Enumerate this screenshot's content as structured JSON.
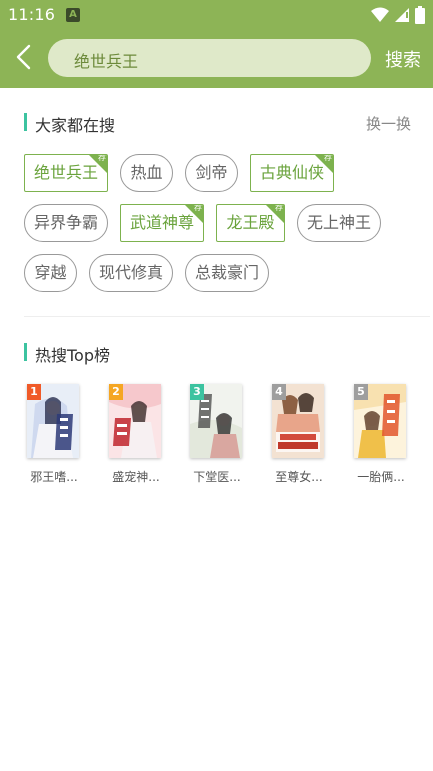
{
  "status": {
    "time": "11:16",
    "notif_icon": "A"
  },
  "search": {
    "query": "绝世兵王",
    "button_label": "搜索"
  },
  "hot_section": {
    "title": "大家都在搜",
    "refresh_label": "换一换"
  },
  "hot_tags": [
    {
      "label": "绝世兵王",
      "recommended": true
    },
    {
      "label": "热血",
      "recommended": false
    },
    {
      "label": "剑帝",
      "recommended": false
    },
    {
      "label": "古典仙侠",
      "recommended": true
    },
    {
      "label": "异界争霸",
      "recommended": false
    },
    {
      "label": "武道神尊",
      "recommended": true
    },
    {
      "label": "龙王殿",
      "recommended": true
    },
    {
      "label": "无上神王",
      "recommended": false
    },
    {
      "label": "穿越",
      "recommended": false
    },
    {
      "label": "现代修真",
      "recommended": false
    },
    {
      "label": "总裁豪门",
      "recommended": false
    }
  ],
  "rec_badge": "荐",
  "top_section": {
    "title": "热搜Top榜"
  },
  "top_books": [
    {
      "rank": "1",
      "title": "邪王嗜...",
      "badge_color": "#f05a28"
    },
    {
      "rank": "2",
      "title": "盛宠神...",
      "badge_color": "#f5a623"
    },
    {
      "rank": "3",
      "title": "下堂医...",
      "badge_color": "#3cc3a0"
    },
    {
      "rank": "4",
      "title": "至尊女...",
      "badge_color": "#9e9e9e"
    },
    {
      "rank": "5",
      "title": "一胎俩...",
      "badge_color": "#9e9e9e"
    }
  ],
  "colors": {
    "header": "#8db456",
    "accent": "#3cc3a0",
    "rec_green": "#7db24e"
  }
}
